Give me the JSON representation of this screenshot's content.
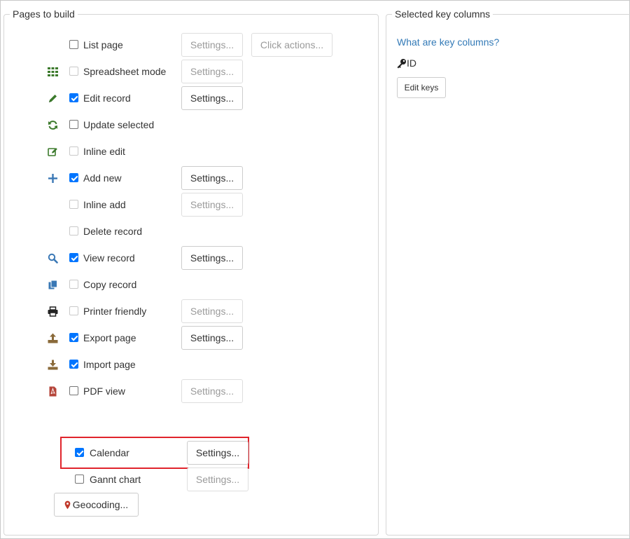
{
  "pages_panel": {
    "legend": "Pages to build",
    "rows": [
      {
        "label": "List page",
        "icon": "none",
        "checked": false,
        "enabled": true,
        "buttons": [
          {
            "label": "Settings...",
            "enabled": false
          },
          {
            "label": "Click actions...",
            "enabled": false
          }
        ]
      },
      {
        "label": "Spreadsheet mode",
        "icon": "grid-icon",
        "checked": false,
        "enabled": false,
        "buttons": [
          {
            "label": "Settings...",
            "enabled": false
          }
        ]
      },
      {
        "label": "Edit record",
        "icon": "pencil-icon",
        "checked": true,
        "enabled": true,
        "buttons": [
          {
            "label": "Settings...",
            "enabled": true
          }
        ]
      },
      {
        "label": "Update selected",
        "icon": "refresh-icon",
        "checked": false,
        "enabled": true,
        "buttons": []
      },
      {
        "label": "Inline edit",
        "icon": "edit-box-icon",
        "checked": false,
        "enabled": false,
        "buttons": []
      },
      {
        "label": "Add new",
        "icon": "plus-icon",
        "checked": true,
        "enabled": true,
        "buttons": [
          {
            "label": "Settings...",
            "enabled": true
          }
        ]
      },
      {
        "label": "Inline add",
        "icon": "none",
        "checked": false,
        "enabled": false,
        "buttons": [
          {
            "label": "Settings...",
            "enabled": false
          }
        ]
      },
      {
        "label": "Delete record",
        "icon": "none",
        "checked": false,
        "enabled": false,
        "buttons": []
      },
      {
        "label": "View record",
        "icon": "search-icon",
        "checked": true,
        "enabled": true,
        "buttons": [
          {
            "label": "Settings...",
            "enabled": true
          }
        ]
      },
      {
        "label": "Copy record",
        "icon": "copy-icon",
        "checked": false,
        "enabled": false,
        "buttons": []
      },
      {
        "label": "Printer friendly",
        "icon": "printer-icon",
        "checked": false,
        "enabled": false,
        "buttons": [
          {
            "label": "Settings...",
            "enabled": false
          }
        ]
      },
      {
        "label": "Export page",
        "icon": "export-icon",
        "checked": true,
        "enabled": true,
        "buttons": [
          {
            "label": "Settings...",
            "enabled": true
          }
        ]
      },
      {
        "label": "Import page",
        "icon": "import-icon",
        "checked": true,
        "enabled": true,
        "buttons": []
      },
      {
        "label": "PDF view",
        "icon": "pdf-icon",
        "checked": false,
        "enabled": true,
        "buttons": [
          {
            "label": "Settings...",
            "enabled": false
          }
        ]
      }
    ],
    "calendar": {
      "label": "Calendar",
      "checked": true,
      "settings_label": "Settings..."
    },
    "gannt": {
      "label": "Gannt chart",
      "checked": false,
      "settings_label": "Settings..."
    },
    "geocoding_label": "Geocoding..."
  },
  "keys_panel": {
    "legend": "Selected key columns",
    "help_link": "What are key columns?",
    "key_column": "ID",
    "edit_keys_label": "Edit keys"
  },
  "colors": {
    "checkbox_accent": "#0075ff",
    "link": "#337ab7",
    "highlight": "#e0242c",
    "icon_green": "#3c7a2c",
    "icon_blue": "#3a78b5",
    "icon_brown": "#8a6a3a"
  }
}
